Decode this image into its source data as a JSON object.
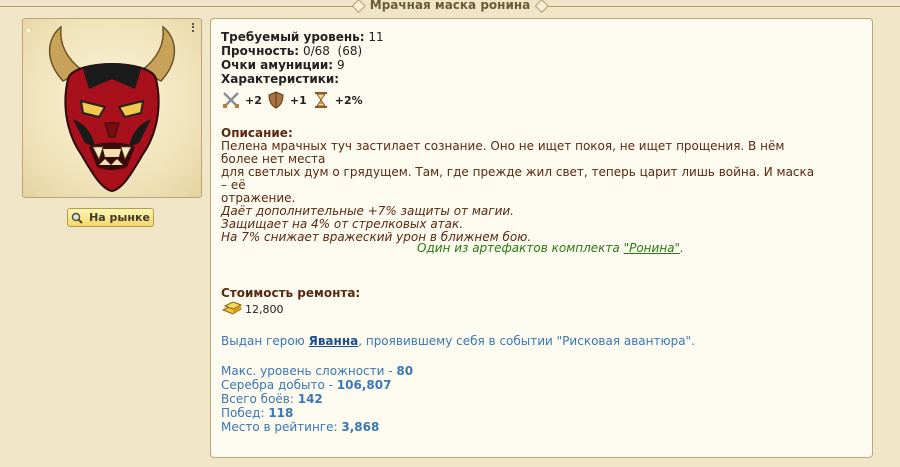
{
  "header": {
    "title": "Мрачная маска ронина"
  },
  "left": {
    "image_alt": "mask-image",
    "market_button": {
      "icon": "magnifier-icon",
      "label": "На рынке"
    }
  },
  "item": {
    "required_level": {
      "label": "Требуемый уровень:",
      "value": "11"
    },
    "durability": {
      "label": "Прочность:",
      "value": "0/68  (68)"
    },
    "ammo_points": {
      "label": "Очки амуниции:",
      "value": "9"
    },
    "characteristics_label": "Характеристики:",
    "characteristics": [
      {
        "icon": "swords-icon",
        "value": "+2"
      },
      {
        "icon": "shield-icon",
        "value": "+1"
      },
      {
        "icon": "hourglass-icon",
        "value": "+2%"
      }
    ],
    "description_label": "Описание:",
    "description_lines": [
      "Пелена мрачных туч застилает сознание. Оно не ищет покоя, не ищет прощения. В нём более нет места",
      "для светлых дум о грядущем. Там, где прежде жил свет, теперь царит лишь война. И маска – её",
      "отражение."
    ],
    "effects": [
      "Даёт дополнительные +7% защиты от магии.",
      "Защищает на 4% от стрелковых атак.",
      "На 7% снижает вражеский урон в ближнем бою."
    ],
    "set_text_before": "Один из артефактов комплекта ",
    "set_link": "\"Ронина\"",
    "set_text_after": ".",
    "repair_label": "Стоимость ремонта:",
    "repair_value": "12,800",
    "issued_before": "Выдан герою ",
    "issued_hero": "Яванна",
    "issued_after": ", проявившему себя в событии \"Рисковая авантюра\".",
    "stats": [
      {
        "label": "Макс. уровень сложности - ",
        "value": "80"
      },
      {
        "label": "Серебра добыто - ",
        "value": "106,807"
      },
      {
        "label": "Всего боёв: ",
        "value": "142"
      },
      {
        "label": "Побед: ",
        "value": "118"
      },
      {
        "label": "Место в рейтинге: ",
        "value": "3,868"
      }
    ]
  },
  "colors": {
    "background": "#f0e6c7",
    "panel": "#fdfaf0",
    "border": "#b9a77a",
    "stats_blue": "#3a78b5",
    "set_green": "#2a7a12",
    "desc_brown": "#5a2a10"
  }
}
